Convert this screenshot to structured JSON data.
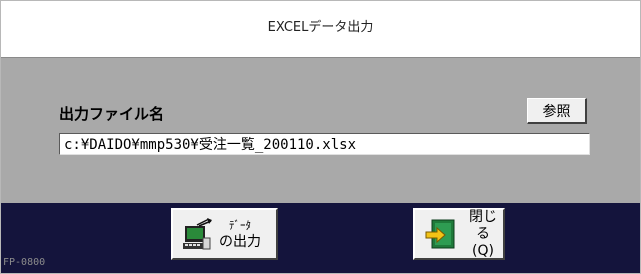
{
  "window": {
    "title": "EXCELデータ出力"
  },
  "form": {
    "file_label": "出力ファイル名",
    "file_path": "c:¥DAIDO¥mmp530¥受注一覧_200110.xlsx",
    "browse_label": "参照"
  },
  "toolbar": {
    "output_button": {
      "line1": "ﾃﾞｰﾀ",
      "line2": "の出力",
      "icon": "computer-export-icon"
    },
    "close_button": {
      "line1": "閉じる",
      "line2": "(Q)",
      "icon": "exit-door-icon"
    }
  },
  "status": {
    "screen_id": "FP-0800"
  },
  "colors": {
    "content_bg": "#a9a9a9",
    "footer_bg": "#14143c",
    "button_face": "#f0f0f0"
  }
}
